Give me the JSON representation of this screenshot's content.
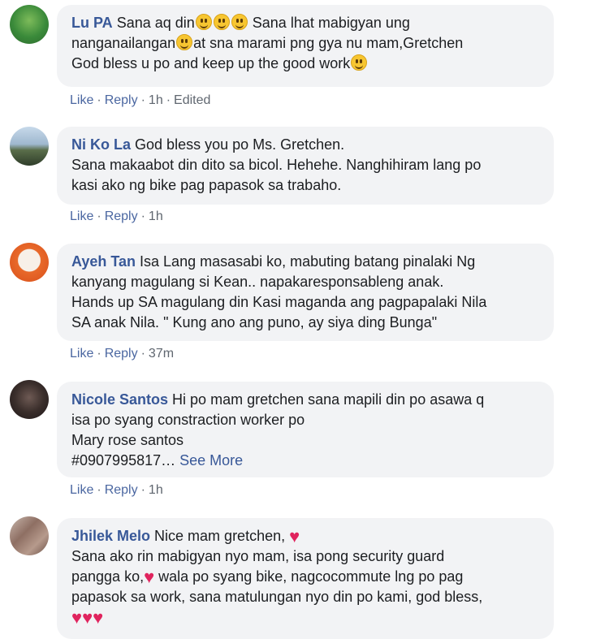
{
  "comments": [
    {
      "author": "Lu PA",
      "lines": [
        "Sana aq din",
        " Sana lhat mabigyan ung",
        "nanganailangan",
        "at sna marami png gya nu mam,Gretchen",
        "God bless u po and keep up the good work"
      ],
      "actions": {
        "like": "Like",
        "reply": "Reply",
        "time": "1h",
        "edited": "Edited"
      }
    },
    {
      "author": "Ni Ko La",
      "lines": [
        "God bless you po Ms. Gretchen.",
        "Sana makaabot din dito sa bicol. Hehehe. Nanghihiram lang po",
        "kasi ako ng bike pag papasok sa trabaho."
      ],
      "actions": {
        "like": "Like",
        "reply": "Reply",
        "time": "1h"
      }
    },
    {
      "author": "Ayeh Tan",
      "lines": [
        "Isa Lang masasabi ko, mabuting batang pinalaki Ng",
        "kanyang magulang si Kean.. napakaresponsableng anak.",
        "Hands up SA magulang din Kasi maganda ang pagpapalaki Nila",
        "SA anak Nila. \" Kung ano ang puno, ay siya ding Bunga\""
      ],
      "actions": {
        "like": "Like",
        "reply": "Reply",
        "time": "37m"
      }
    },
    {
      "author": "Nicole Santos",
      "lines": [
        "Hi po mam gretchen sana mapili din po asawa q",
        "isa po syang constraction worker po",
        "Mary rose santos",
        "#0907995817…"
      ],
      "see_more": "See More",
      "actions": {
        "like": "Like",
        "reply": "Reply",
        "time": "1h"
      }
    },
    {
      "author": "Jhilek Melo",
      "lines": [
        "Nice mam gretchen,",
        "Sana ako rin mabigyan nyo mam, isa pong security guard",
        "pangga ko,",
        " wala po syang bike, nagcocommute lng po pag",
        "papasok sa work, sana matulungan nyo din po kami, god bless,"
      ]
    }
  ],
  "separator": "·",
  "icons": {
    "grin": "grinning-face-emoji",
    "heart": "red-heart-emoji"
  },
  "colors": {
    "bubble": "#f2f3f5",
    "author": "#385898",
    "actions": "#606770",
    "heart": "#e0245e"
  }
}
